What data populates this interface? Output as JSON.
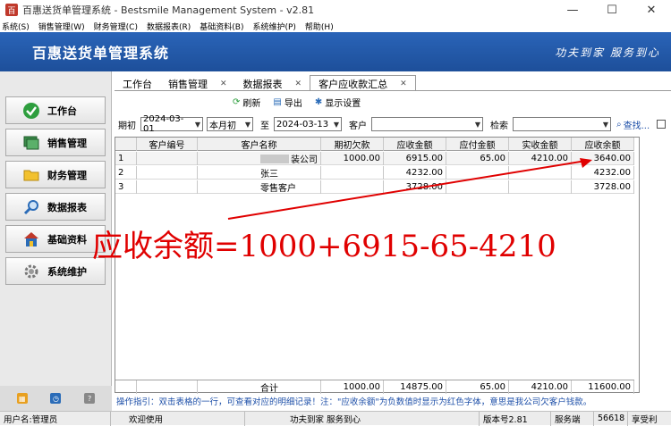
{
  "window": {
    "title": "百惠送货单管理系统 - Bestsmile Management System - v2.81",
    "minimize": "—",
    "maximize": "☐",
    "close": "✕"
  },
  "menu": [
    "系统(S)",
    "销售管理(W)",
    "财务管理(C)",
    "数据报表(R)",
    "基础资料(B)",
    "系统维护(P)",
    "帮助(H)"
  ],
  "banner": {
    "title": "百惠送货单管理系统",
    "slogan": "功夫到家 服务到心"
  },
  "sidebar": {
    "items": [
      {
        "label": "工作台",
        "icon": "check-circle-icon",
        "color": "#2e9e3e"
      },
      {
        "label": "销售管理",
        "icon": "monitor-icon",
        "color": "#2f7d3a"
      },
      {
        "label": "财务管理",
        "icon": "folder-icon",
        "color": "#f2c12e"
      },
      {
        "label": "数据报表",
        "icon": "magnifier-icon",
        "color": "#2b6cb8"
      },
      {
        "label": "基础资料",
        "icon": "building-icon",
        "color": "#c0392b"
      },
      {
        "label": "系统维护",
        "icon": "gear-icon",
        "color": "#888888"
      }
    ]
  },
  "tabs": [
    {
      "label": "工作台",
      "closable": false
    },
    {
      "label": "销售管理",
      "closable": true
    },
    {
      "label": "数据报表",
      "closable": true
    },
    {
      "label": "客户应收款汇总",
      "closable": true
    }
  ],
  "toolbar": {
    "refresh": "刷新",
    "export": "导出",
    "display_settings": "显示设置"
  },
  "filters": {
    "period_label": "期初",
    "start_date": "2024-03-01",
    "preset": "本月初",
    "to_label": "至",
    "end_date": "2024-03-13",
    "customer_label": "客户",
    "customer_value": "",
    "search_label": "检索",
    "search_value": "",
    "find_button": "查找..."
  },
  "table": {
    "columns": [
      "",
      "客户编号",
      "客户名称",
      "期初欠款",
      "应收金额",
      "应付金额",
      "实收金额",
      "应收余额"
    ],
    "rows": [
      {
        "no": "1",
        "code": "",
        "name": "装公司",
        "opening": "1000.00",
        "receivable": "6915.00",
        "payable": "65.00",
        "received": "4210.00",
        "balance": "3640.00"
      },
      {
        "no": "2",
        "code": "",
        "name": "张三",
        "opening": "",
        "receivable": "4232.00",
        "payable": "",
        "received": "",
        "balance": "4232.00"
      },
      {
        "no": "3",
        "code": "",
        "name": "零售客户",
        "opening": "",
        "receivable": "3728.00",
        "payable": "",
        "received": "",
        "balance": "3728.00"
      }
    ],
    "totals": {
      "label": "合计",
      "opening": "1000.00",
      "receivable": "14875.00",
      "payable": "65.00",
      "received": "4210.00",
      "balance": "11600.00"
    }
  },
  "hint": "操作指引：双击表格的一行，可查看对应的明细记录！注：\"应收余额\"为负数值时显示为红色字体，意思是我公司欠客户钱款。",
  "annotation": "应收余额=1000+6915-65-4210",
  "status": {
    "user": "用户名:管理员",
    "welcome": "欢迎使用",
    "motto": "功夫到家 服务到心",
    "version": "版本号2.81",
    "server_label": "服务端",
    "server_port": "56618",
    "user_right": "享受利"
  },
  "colors": {
    "banner": "#2a64b8",
    "hint": "#1d4fa8",
    "annotation": "#e00000"
  }
}
